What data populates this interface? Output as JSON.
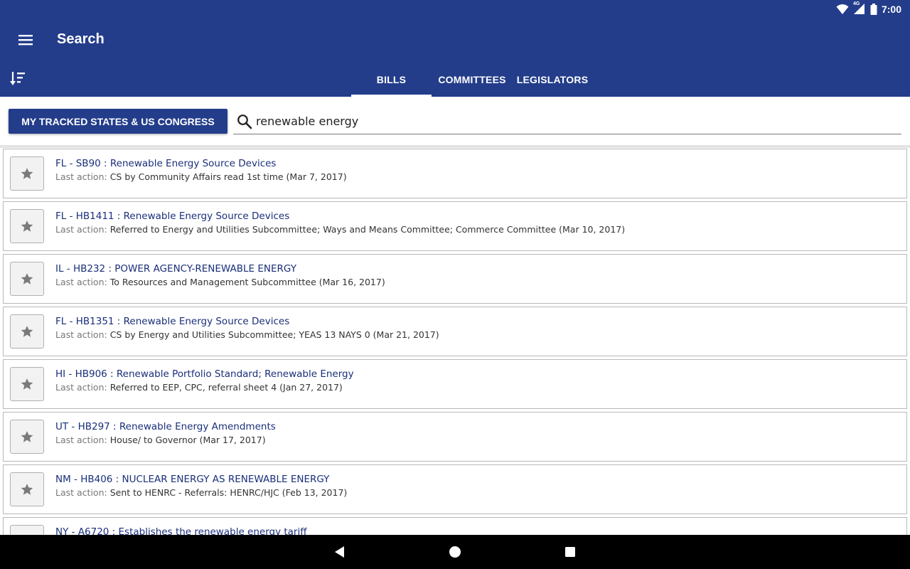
{
  "statusbar": {
    "time": "7:00",
    "network_label": "4G"
  },
  "appbar": {
    "title": "Search"
  },
  "tabs": [
    {
      "label": "BILLS",
      "active": true
    },
    {
      "label": "COMMITTEES",
      "active": false
    },
    {
      "label": "LEGISLATORS",
      "active": false
    }
  ],
  "filter": {
    "scope_button_label": "MY TRACKED STATES & US CONGRESS"
  },
  "search": {
    "value": "renewable energy",
    "placeholder": ""
  },
  "results": {
    "last_action_label": "Last action:",
    "items": [
      {
        "title": "FL - SB90 : Renewable Energy Source Devices",
        "last_action": "CS by Community Affairs read 1st time (Mar 7, 2017)"
      },
      {
        "title": "FL - HB1411 : Renewable Energy Source Devices",
        "last_action": "Referred to Energy and Utilities Subcommittee; Ways and Means Committee; Commerce Committee (Mar 10, 2017)"
      },
      {
        "title": "IL - HB232 : POWER AGENCY-RENEWABLE ENERGY",
        "last_action": "To Resources and Management Subcommittee (Mar 16, 2017)"
      },
      {
        "title": "FL - HB1351 : Renewable Energy Source Devices",
        "last_action": "CS by Energy and Utilities Subcommittee; YEAS 13 NAYS 0 (Mar 21, 2017)"
      },
      {
        "title": "HI - HB906 : Renewable Portfolio Standard; Renewable Energy",
        "last_action": "Referred to EEP, CPC, referral sheet 4 (Jan 27, 2017)"
      },
      {
        "title": "UT - HB297 : Renewable Energy Amendments",
        "last_action": "House/ to Governor (Mar 17, 2017)"
      },
      {
        "title": "NM - HB406 : NUCLEAR ENERGY AS RENEWABLE ENERGY",
        "last_action": "Sent to HENRC - Referrals: HENRC/HJC (Feb 13, 2017)"
      },
      {
        "title": "NY - A6720 : Establishes the renewable energy tariff",
        "last_action": ""
      }
    ]
  },
  "colors": {
    "primary": "#233d8b",
    "link": "#1a2f7a",
    "star": "#7a7a7a"
  },
  "icons": {
    "menu": "menu-icon",
    "sort": "sort-icon",
    "search": "search-icon",
    "star": "star-icon",
    "nav_back": "back-icon",
    "nav_home": "home-icon",
    "nav_recents": "recents-icon"
  }
}
